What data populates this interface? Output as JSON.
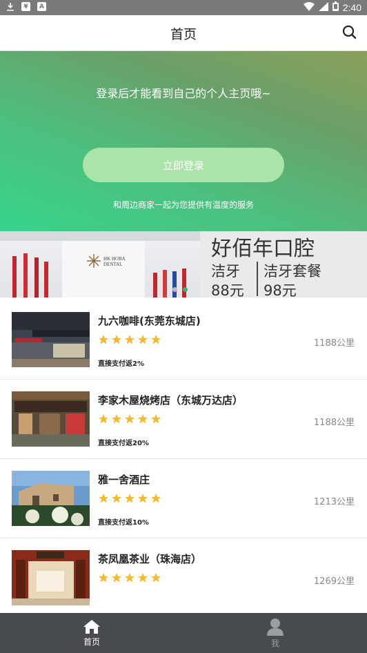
{
  "status_bar": {
    "time": "2:40",
    "left_icons": [
      "download-icon",
      "yen-icon",
      "a-icon"
    ],
    "right_icons": [
      "wifi-icon",
      "signal-icon",
      "battery-icon"
    ]
  },
  "header": {
    "title": "首页",
    "search_icon": "search-icon"
  },
  "hero": {
    "message": "登录后才能看到自己的个人主页哦~",
    "login_button": "立即登录",
    "subtitle": "和周边商家一起为您提供有温度的服务"
  },
  "banner": {
    "brand": [
      "HK HOBA",
      "DENTAL"
    ],
    "title": "好佰年口腔",
    "left_top": "洁牙",
    "left_bottom": "88元",
    "right_top": "洁牙套餐",
    "right_bottom": "98元",
    "slide_count": 2,
    "active_slide": 1
  },
  "shops": [
    {
      "name": "九六咖啡(东莞东城店)",
      "rating": 5,
      "distance": "1188公里",
      "cashback": "直接支付返2%"
    },
    {
      "name": "李家木屋烧烤店（东城万达店）",
      "rating": 5,
      "distance": "1188公里",
      "cashback": "直接支付返20%"
    },
    {
      "name": "雅一舍酒庄",
      "rating": 5,
      "distance": "1213公里",
      "cashback": "直接支付返10%"
    },
    {
      "name": "茶凤凰茶业（珠海店）",
      "rating": 5,
      "distance": "1269公里",
      "cashback": ""
    }
  ],
  "tabbar": {
    "tabs": [
      {
        "label": "首页",
        "icon": "home-icon",
        "active": true
      },
      {
        "label": "我",
        "icon": "person-icon",
        "active": false
      }
    ]
  },
  "colors": {
    "hero_gradient": [
      "#36d48b",
      "#8aa05a"
    ],
    "login_button": "#abe4a8",
    "star": "#f6b92b",
    "tabbar": "#474a4f",
    "status_bar": "#7a7a7a"
  }
}
